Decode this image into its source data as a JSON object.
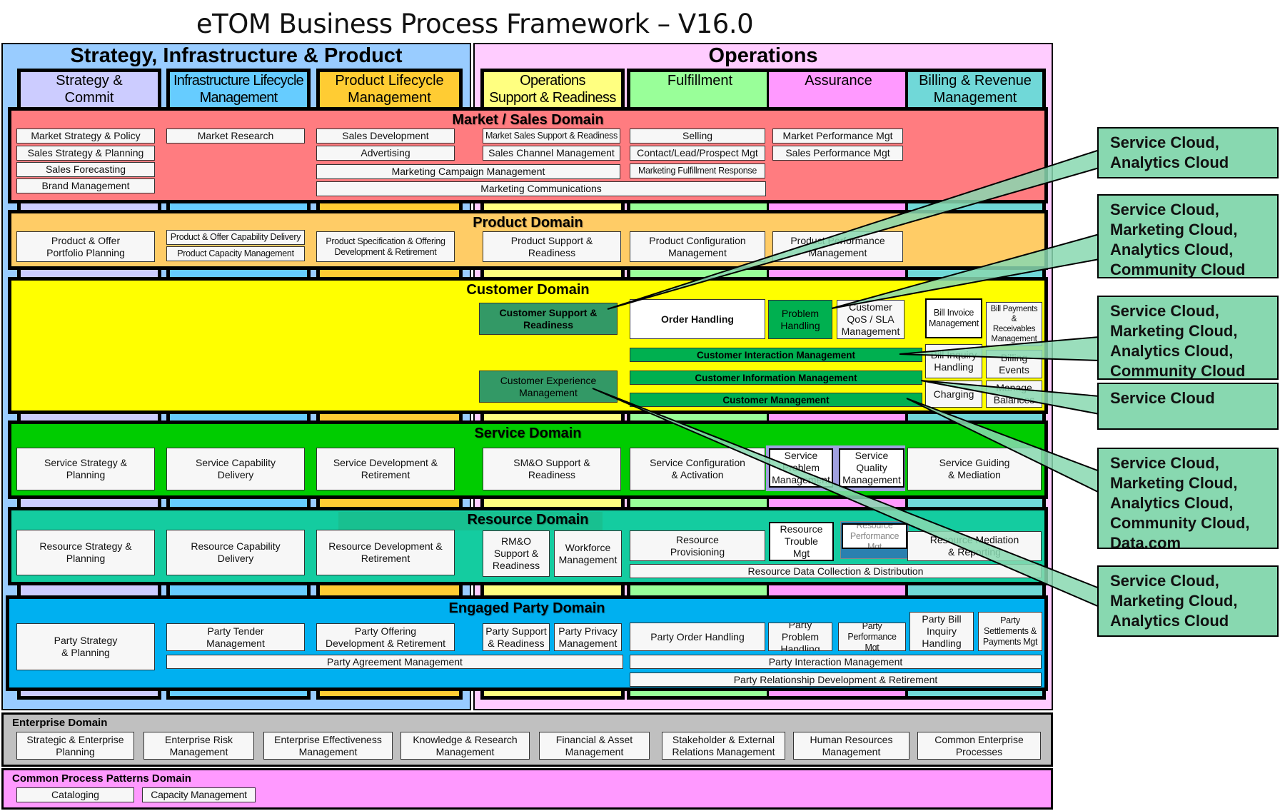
{
  "title": "eTOM Business Process Framework – V16.0",
  "sip": {
    "title": "Strategy, Infrastructure & Product",
    "columns": [
      "Strategy &\nCommit",
      "Infrastructure Lifecycle\nManagement",
      "Product Lifecycle\nManagement"
    ]
  },
  "ops": {
    "title": "Operations",
    "columns": [
      "Operations\nSupport & Readiness",
      "Fulfillment",
      "Assurance",
      "Billing & Revenue\nManagement"
    ]
  },
  "colors": {
    "sip_bg": "#99ccff",
    "ops_bg": "#ffccff",
    "strategy_commit": "#ccccff",
    "infra_lifecycle": "#66ccff",
    "product_lifecycle": "#ffcc33",
    "ops_support": "#ffff80",
    "fulfillment": "#99ff99",
    "assurance": "#ff99ff",
    "billing": "#70d8d8",
    "market_domain": "#ff7c80",
    "product_domain": "#ffcc66",
    "customer_domain": "#ffff00",
    "service_domain": "#00cc00",
    "resource_domain": "#14cca0",
    "party_domain": "#00b0f0",
    "enterprise_domain": "#c0c0c0",
    "patterns_domain": "#ff99ff",
    "callout": "#88d8b0"
  },
  "market": {
    "title": "Market / Sales Domain",
    "items": {
      "market_strategy": "Market  Strategy & Policy",
      "sales_strategy": "Sales Strategy & Planning",
      "sales_forecasting": "Sales Forecasting",
      "brand": "Brand Management",
      "market_research": "Market  Research",
      "sales_dev": "Sales Development",
      "advertising": "Advertising",
      "campaign": "Marketing  Campaign Management",
      "communications": "Marketing  Communications",
      "msr": "Market Sales Support & Readiness",
      "channel": "Sales Channel Management",
      "selling": "Selling",
      "contact": "Contact/Lead/Prospect Mgt",
      "fulfillment_resp": "Marketing Fulfillment Response",
      "market_perf": "Market  Performance Mgt",
      "sales_perf": "Sales Performance Mgt"
    }
  },
  "product": {
    "title": "Product Domain",
    "items": {
      "portfolio": "Product & Offer\nPortfolio Planning",
      "capability": "Product &  Offer Capability Delivery",
      "capacity": "Product Capacity Management",
      "spec": "Product Specification & Offering\nDevelopment & Retirement",
      "support": "Product Support &\nReadiness",
      "config": "Product Configuration\nManagement",
      "perf": "Product Performance\nManagement"
    }
  },
  "customer": {
    "title": "Customer Domain",
    "items": {
      "support": "Customer Support &\nReadiness",
      "experience": "Customer Experience\nManagement",
      "order": "Order Handling",
      "problem": "Problem\nHandling",
      "qos": "Customer\nQoS / SLA\nManagement",
      "interaction": "Customer Interaction Management",
      "information": "Customer Information  Management",
      "management": "Customer Management",
      "bill_invoice": "Bill Invoice\nManagement",
      "bill_payments": "Bill Payments\n&\nReceivables\nManagement",
      "bill_inquiry": "Bill Inquiry\nHandling",
      "billing_events": "Billing\nEvents",
      "charging": "Charging",
      "balances": "Manage\nBalances"
    }
  },
  "service": {
    "title": "Service Domain",
    "items": {
      "strategy": "Service Strategy &\nPlanning",
      "capability": "Service Capability\nDelivery",
      "development": "Service Development &\nRetirement",
      "smo": "SM&O Support &\nReadiness",
      "config": "Service Configuration\n& Activation",
      "problem": "Service\nProblem\nManagement",
      "quality": "Service\nQuality\nManagement",
      "guiding": "Service Guiding\n& Mediation"
    }
  },
  "resource": {
    "title": "Resource Domain",
    "items": {
      "strategy": "Resource Strategy &\nPlanning",
      "capability": "Resource Capability\nDelivery",
      "development": "Resource  Development &\nRetirement",
      "rmo": "RM&O\nSupport &\nReadiness",
      "workforce": "Workforce\nManagement",
      "provisioning": "Resource\nProvisioning",
      "trouble": "Resource\nTrouble\nMgt",
      "performance": "Resource\nPerformance Mgt",
      "mediation": "Resource Mediation\n& Reporting",
      "data": "Resource Data Collection & Distribution"
    }
  },
  "party": {
    "title": "Engaged Party Domain",
    "items": {
      "strategy": "Party Strategy\n& Planning",
      "tender": "Party Tender\nManagement",
      "offering": "Party Offering\nDevelopment & Retirement",
      "support": "Party Support\n& Readiness",
      "privacy": "Party Privacy\nManagement",
      "agreement": "Party Agreement Management",
      "order": "Party Order Handling",
      "problem": "Party Problem\nHandling",
      "performance": "Party\nPerformance Mgt",
      "bill_inquiry": "Party Bill\nInquiry\nHandling",
      "settlements": "Party\nSettlements &\nPayments Mgt",
      "interaction": "Party Interaction  Management",
      "relationship": "Party Relationship Development & Retirement"
    }
  },
  "enterprise": {
    "title": "Enterprise Domain",
    "items": [
      "Strategic & Enterprise\nPlanning",
      "Enterprise Risk\nManagement",
      "Enterprise Effectiveness\nManagement",
      "Knowledge & Research\nManagement",
      "Financial & Asset\nManagement",
      "Stakeholder & External\nRelations Management",
      "Human Resources\nManagement",
      "Common Enterprise\nProcesses"
    ]
  },
  "patterns": {
    "title": "Common  Process Patterns Domain",
    "items": [
      "Cataloging",
      "Capacity Management"
    ]
  },
  "callouts": [
    "Service Cloud,\nAnalytics Cloud",
    "Service Cloud,\nMarketing Cloud,\nAnalytics Cloud,\nCommunity Cloud",
    "Service Cloud,\nMarketing Cloud,\nAnalytics Cloud,\nCommunity Cloud",
    "Service Cloud",
    "Service Cloud,\nMarketing Cloud,\nAnalytics Cloud,\nCommunity Cloud,\nData.com",
    "Service Cloud,\nMarketing Cloud,\nAnalytics Cloud"
  ]
}
